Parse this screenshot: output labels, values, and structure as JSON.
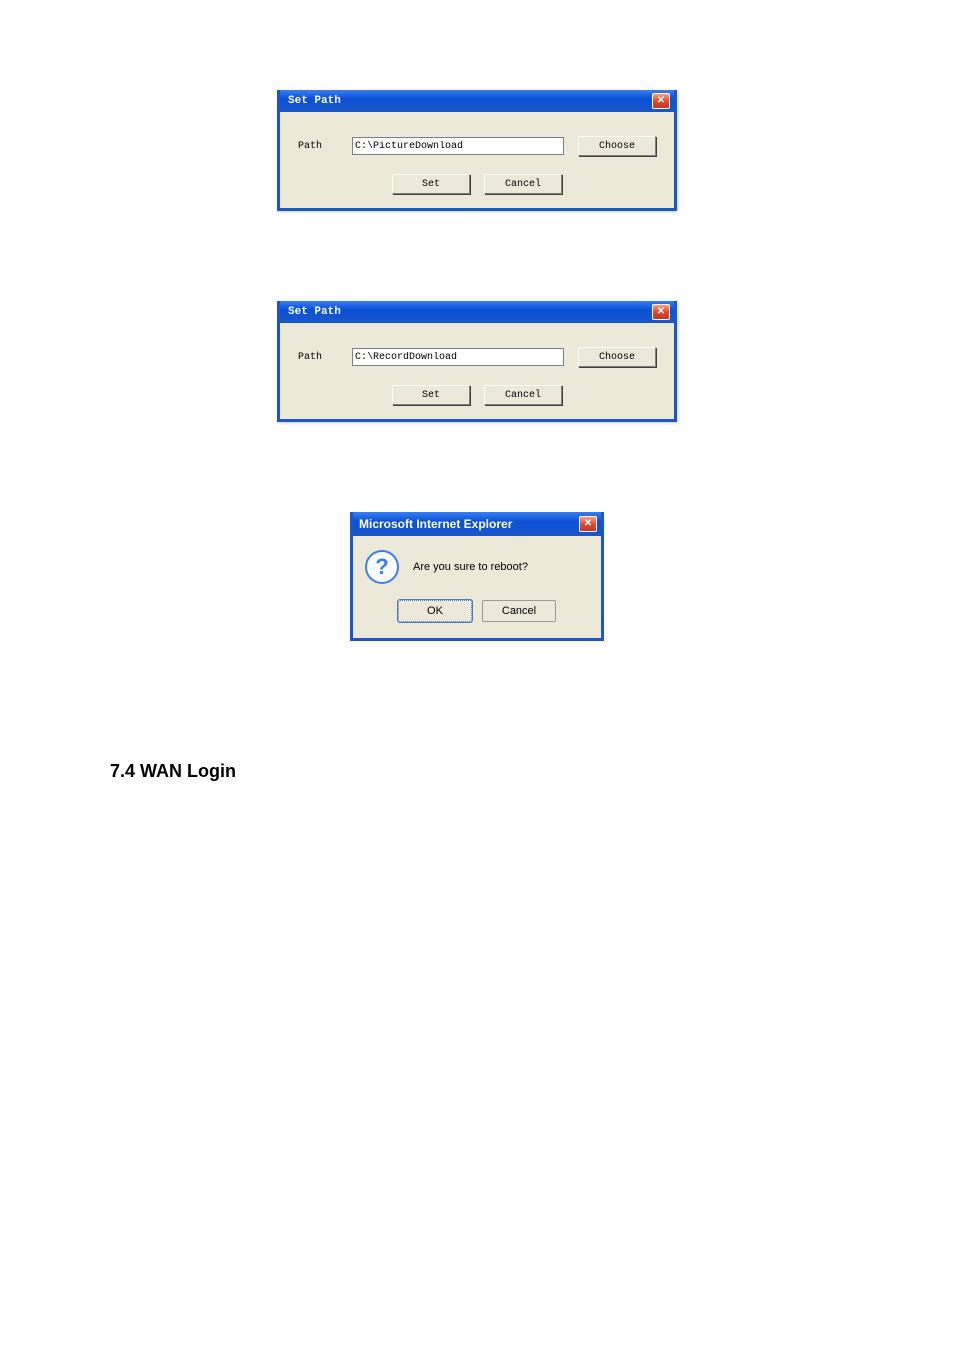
{
  "dialog1": {
    "title": "Set Path",
    "path_label": "Path",
    "path_value": "C:\\PictureDownload",
    "choose": "Choose",
    "set": "Set",
    "cancel": "Cancel"
  },
  "dialog2": {
    "title": "Set Path",
    "path_label": "Path",
    "path_value": "C:\\RecordDownload",
    "choose": "Choose",
    "set": "Set",
    "cancel": "Cancel"
  },
  "confirm": {
    "title": "Microsoft Internet Explorer",
    "message": "Are you sure to reboot?",
    "ok": "OK",
    "cancel": "Cancel"
  },
  "heading": "7.4  WAN Login"
}
